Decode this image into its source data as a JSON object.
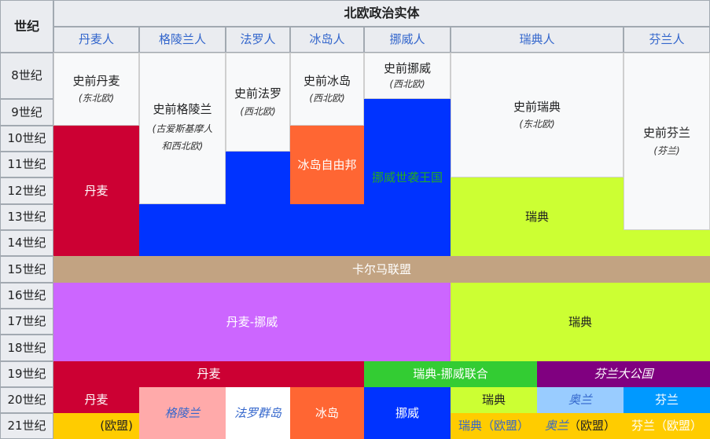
{
  "table": {
    "corner_label": "世纪",
    "title": "北欧政治实体",
    "peoples": [
      "丹麦人",
      "格陵兰人",
      "法罗人",
      "冰岛人",
      "挪威人",
      "瑞典人",
      "芬兰人"
    ],
    "centuries": [
      "8世纪",
      "9世纪",
      "10世纪",
      "11世纪",
      "12世纪",
      "13世纪",
      "14世纪",
      "15世纪",
      "16世纪",
      "17世纪",
      "18世纪",
      "19世纪",
      "20世纪",
      "21世纪"
    ]
  },
  "prehistoric": [
    {
      "name": "史前丹麦",
      "region": "(东北欧)"
    },
    {
      "name": "史前格陵兰",
      "region": "(古爱斯基摩人\n和西北欧)"
    },
    {
      "name": "史前法罗",
      "region": "(西北欧)"
    },
    {
      "name": "史前冰岛",
      "region": "(西北欧)"
    },
    {
      "name": "史前挪威",
      "region": "(西北欧)"
    },
    {
      "name": "史前瑞典",
      "region": "(东北欧)"
    },
    {
      "name": "史前芬兰",
      "region": "(芬兰)"
    }
  ],
  "states": {
    "denmark_medieval": "丹麦",
    "iceland_commonwealth": "冰岛自由邦",
    "norway_kingdom": "挪威世袭王国",
    "sweden_medieval": "瑞典",
    "kalmar_union": "卡尔马联盟",
    "denmark_norway": "丹麦-挪威",
    "sweden_early_modern": "瑞典",
    "denmark_19": "丹麦",
    "sweden_norway": "瑞典-挪威联合",
    "finland_grand_duchy": "芬兰大公国",
    "denmark_20": "丹麦",
    "denmark_eu": "(欧盟)",
    "greenland": "格陵兰",
    "faroe": "法罗群岛",
    "iceland": "冰岛",
    "norway": "挪威",
    "sweden_20": "瑞典",
    "sweden_eu": "瑞典（欧盟）",
    "aland_20": "奥兰",
    "aland_eu_name": "奥兰",
    "aland_eu_suffix": "（欧盟）",
    "finland_20": "芬兰",
    "finland_eu": "芬兰（欧盟）"
  },
  "colors": {
    "header_bg": "#eaecf0",
    "prehistoric_bg": "#f8f9fa",
    "denmark_red": "#cc0033",
    "blue": "#0033ff",
    "iceland_orange": "#ff6633",
    "lime": "#ccff33",
    "kalmar_tan": "#c2a382",
    "violet": "#cc66ff",
    "sweden_norway_green": "#33cc33",
    "finland_purple": "#800080",
    "greenland_pink": "#ffaaaa",
    "eu_gold": "#ffcc00",
    "aland_lightblue": "#99ccff",
    "finland_blue": "#0099ff"
  }
}
